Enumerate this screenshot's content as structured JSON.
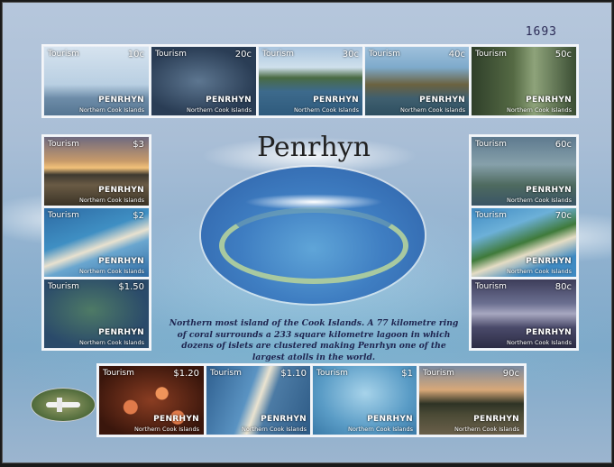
{
  "sheet": {
    "number": "1693",
    "title": "Penrhyn",
    "caption": "Northern most island of the Cook Islands. A 77 kilometre ring of coral surrounds a 233 square kilometre lagoon in which dozens of islets are clustered making Penrhyn one of the largest atolls in the world."
  },
  "stamp_common": {
    "category": "Tourism",
    "country": "PENRHYN",
    "subtitle": "Northern Cook Islands"
  },
  "stamps": [
    {
      "value": "10c"
    },
    {
      "value": "20c"
    },
    {
      "value": "30c"
    },
    {
      "value": "40c"
    },
    {
      "value": "50c"
    },
    {
      "value": "$3"
    },
    {
      "value": "$2"
    },
    {
      "value": "$1.50"
    },
    {
      "value": "60c"
    },
    {
      "value": "70c"
    },
    {
      "value": "80c"
    },
    {
      "value": "$1.20"
    },
    {
      "value": "$1.10"
    },
    {
      "value": "$1"
    },
    {
      "value": "90c"
    }
  ],
  "colors": {
    "sheet": "#a9bed6",
    "title_text": "#222222",
    "caption_text": "#1e2550"
  }
}
